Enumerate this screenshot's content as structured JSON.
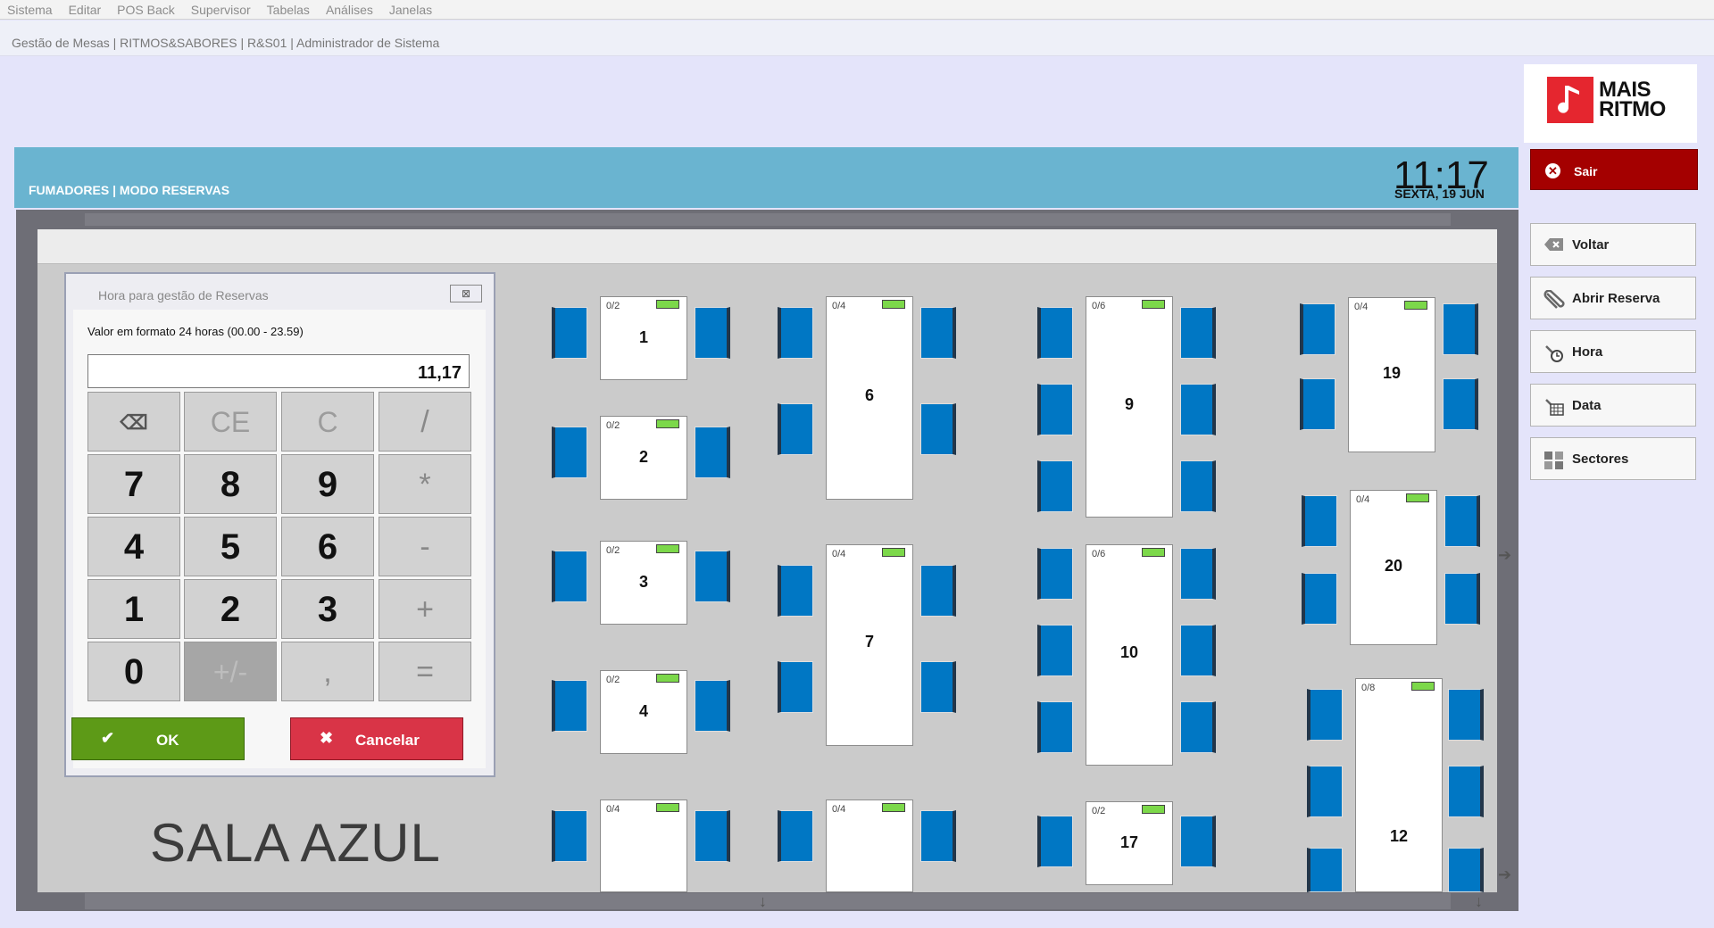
{
  "menu": [
    "Sistema",
    "Editar",
    "POS Back",
    "Supervisor",
    "Tabelas",
    "Análises",
    "Janelas"
  ],
  "window_title": "Gestão de Mesas | RITMOS&SABORES | R&S01 | Administrador de Sistema",
  "logo": {
    "line1": "MAIS",
    "line2": "RITMO"
  },
  "header": {
    "title": "FUMADORES | MODO RESERVAS",
    "time": "11:17",
    "date": "SEXTA, 19 JUN"
  },
  "sidebar": {
    "exit_label": "Sair",
    "items": [
      {
        "label": "Voltar",
        "icon": "backspace-icon"
      },
      {
        "label": "Abrir Reserva",
        "icon": "paperclip-icon"
      },
      {
        "label": "Hora",
        "icon": "clock-icon"
      },
      {
        "label": "Data",
        "icon": "calendar-icon"
      },
      {
        "label": "Sectores",
        "icon": "grid-icon"
      }
    ]
  },
  "room_name": "SALA   AZUL",
  "dialog": {
    "title": "Hora para gestão de Reservas",
    "prompt": "Valor em formato 24 horas (00.00 - 23.59)",
    "value": "11,17",
    "keys": [
      "⌫",
      "CE",
      "C",
      "/",
      "7",
      "8",
      "9",
      "*",
      "4",
      "5",
      "6",
      "-",
      "1",
      "2",
      "3",
      "+",
      "0",
      "+/-",
      ",",
      "="
    ],
    "ok_label": "OK",
    "cancel_label": "Cancelar"
  },
  "tables": [
    {
      "num": "1",
      "occ": "0/2"
    },
    {
      "num": "2",
      "occ": "0/2"
    },
    {
      "num": "3",
      "occ": "0/2"
    },
    {
      "num": "4",
      "occ": "0/2"
    },
    {
      "num": "",
      "occ": "0/4"
    },
    {
      "num": "6",
      "occ": "0/4"
    },
    {
      "num": "7",
      "occ": "0/4"
    },
    {
      "num": "",
      "occ": "0/4"
    },
    {
      "num": "9",
      "occ": "0/6"
    },
    {
      "num": "10",
      "occ": "0/6"
    },
    {
      "num": "17",
      "occ": "0/2"
    },
    {
      "num": "19",
      "occ": "0/4"
    },
    {
      "num": "20",
      "occ": "0/4"
    },
    {
      "num": "12",
      "occ": "0/8"
    }
  ],
  "colors": {
    "header": "#6ab4d0",
    "exit": "#a40000",
    "chair": "#0077c4",
    "lamp": "#7cd84a",
    "ok": "#5d9a17",
    "cancel": "#d93447"
  }
}
